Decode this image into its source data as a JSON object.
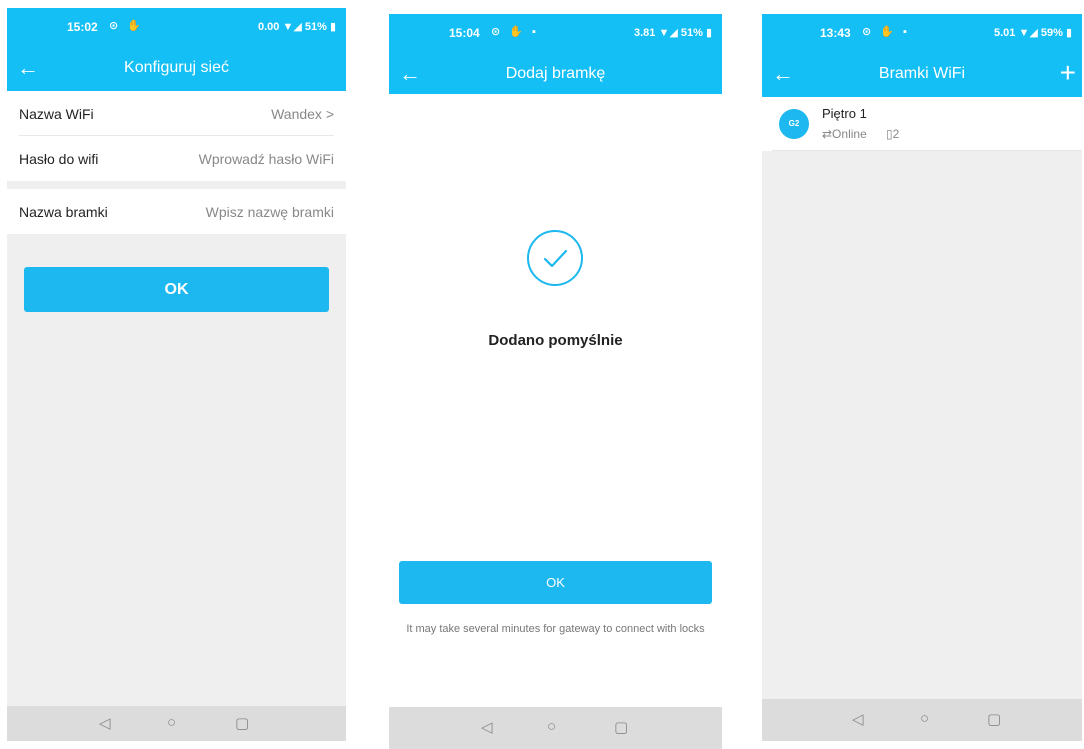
{
  "screen1": {
    "status": {
      "time": "15:02",
      "icons": "⊙ ✋",
      "right": "0.00 ▼◢ 51% ▮"
    },
    "title": "Konfiguruj sieć",
    "rows": [
      {
        "label": "Nazwa WiFi",
        "value": "Wandex >"
      },
      {
        "label": "Hasło do wifi",
        "value": "Wprowadź hasło WiFi"
      },
      {
        "label": "Nazwa bramki",
        "value": "Wpisz nazwę bramki"
      }
    ],
    "ok_label": "OK"
  },
  "screen2": {
    "status": {
      "time": "15:04",
      "icons": "⊙ ✋ ▪",
      "right": "3.81 ▼◢ 51% ▮"
    },
    "title": "Dodaj bramkę",
    "success": "Dodano pomyślnie",
    "ok_label": "OK",
    "note": "It may take several minutes for gateway to connect with locks"
  },
  "screen3": {
    "status": {
      "time": "13:43",
      "icons": "⊙ ✋ ▪",
      "right": "5.01 ▼◢ 59% ▮"
    },
    "title": "Bramki WiFi",
    "gateway": {
      "icon_text": "G2",
      "name": "Piętro 1",
      "status": "⇄Online",
      "count": "▯2"
    }
  },
  "nav": {
    "back": "◁",
    "home": "○",
    "recent": "▢"
  },
  "colors": {
    "accent": "#14bff5",
    "button": "#1db8ef"
  },
  "icons": {
    "back": "arrow-left-icon",
    "check": "check-circle-icon",
    "plus": "plus-icon"
  }
}
